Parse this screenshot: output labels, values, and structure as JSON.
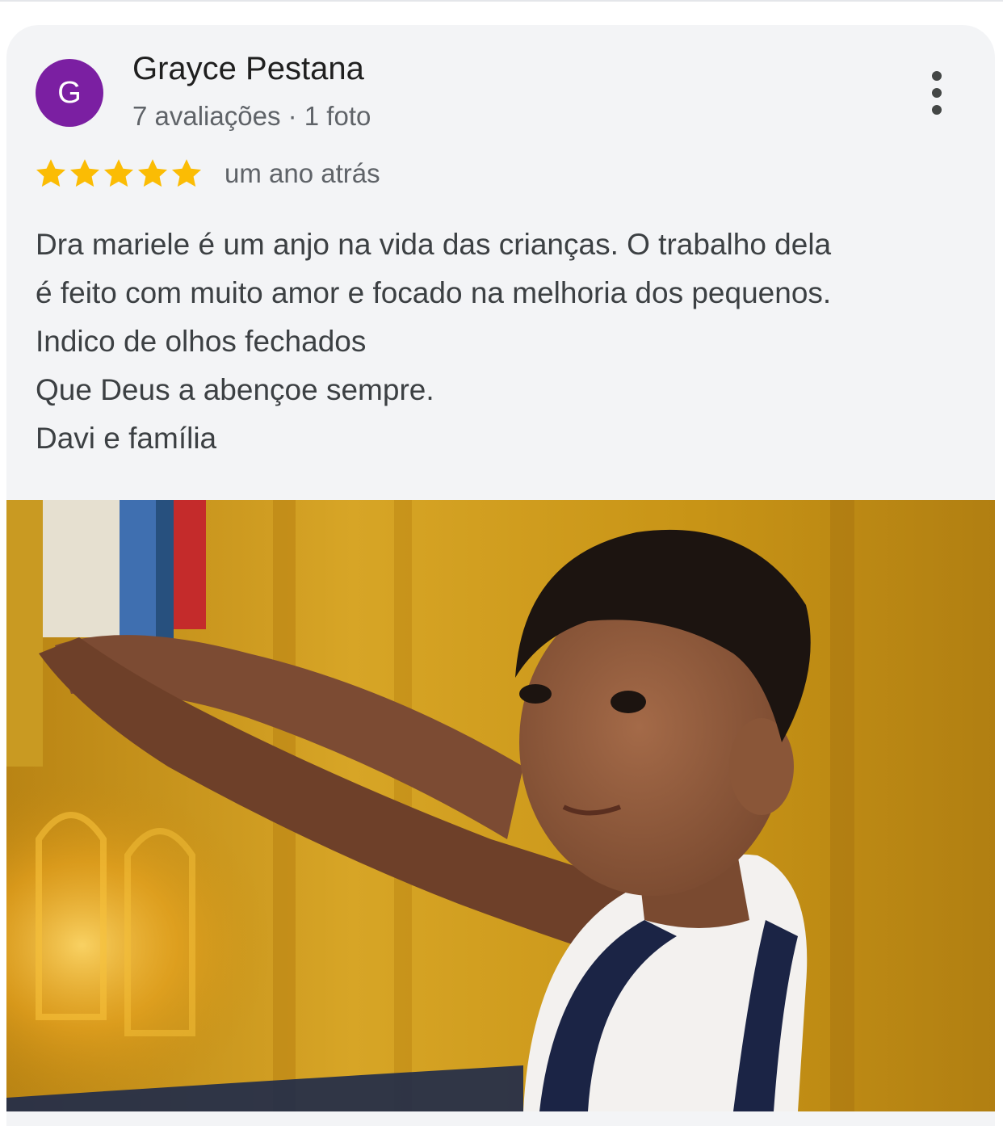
{
  "review": {
    "avatar_letter": "G",
    "avatar_color": "#7b1fa2",
    "reviewer_name": "Grayce Pestana",
    "reviewer_meta": "7 avaliações · 1 foto",
    "rating": 5,
    "rating_max": 5,
    "star_color": "#fbbc04",
    "date": "um ano atrás",
    "text_lines": [
      "Dra mariele é um anjo na vida das crianças. O trabalho dela",
      "é feito com muito amor e focado na melhoria dos pequenos.",
      "Indico de olhos fechados",
      "Que Deus a abençoe sempre.",
      "Davi e família"
    ],
    "more_icon": "more-vert-icon",
    "photo_count_shown": 1
  }
}
